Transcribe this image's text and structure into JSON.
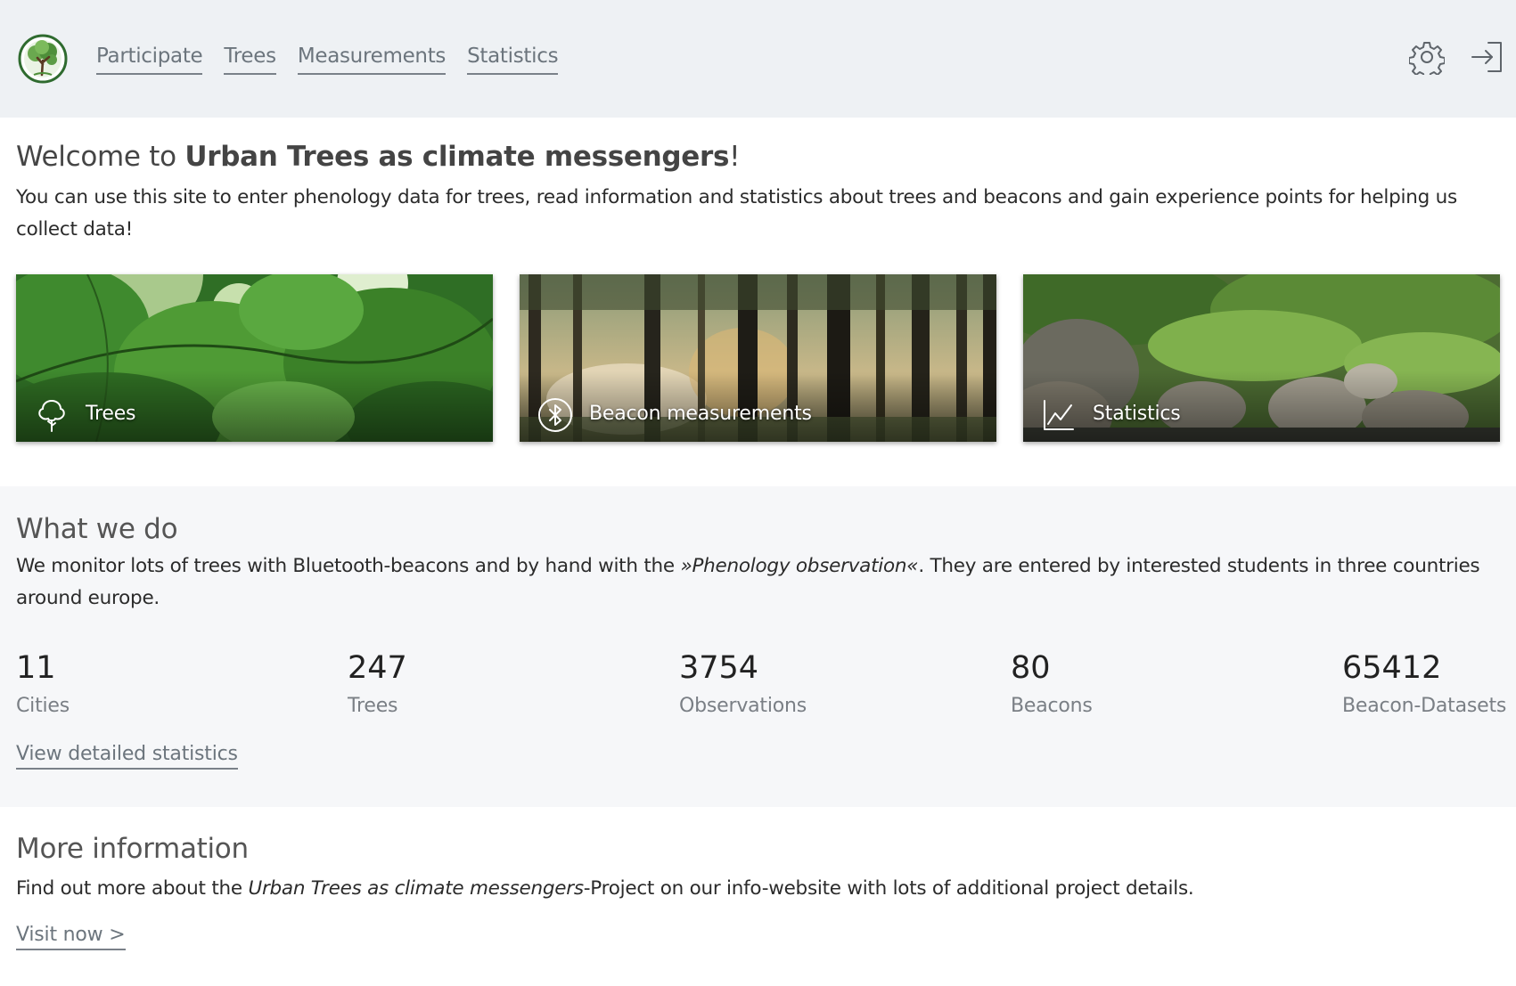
{
  "header": {
    "nav": [
      {
        "label": "Participate"
      },
      {
        "label": "Trees"
      },
      {
        "label": "Measurements"
      },
      {
        "label": "Statistics"
      }
    ]
  },
  "intro": {
    "welcome_prefix": "Welcome to ",
    "welcome_name": "Urban Trees as climate messengers",
    "welcome_suffix": "!",
    "text": "You can use this site to enter phenology data for trees, read information and statistics about trees and beacons and gain experience points for helping us collect data!"
  },
  "cards": [
    {
      "label": "Trees",
      "icon": "tree-icon"
    },
    {
      "label": "Beacon measurements",
      "icon": "bluetooth-icon"
    },
    {
      "label": "Statistics",
      "icon": "chart-line-icon"
    }
  ],
  "what_we_do": {
    "title": "What we do",
    "text_before": "We monitor lots of trees with Bluetooth-beacons and by hand with the ",
    "text_em": "»Phenology observation«",
    "text_after": ". They are entered by interested students in three countries around europe.",
    "stats": [
      {
        "value": "11",
        "label": "Cities"
      },
      {
        "value": "247",
        "label": "Trees"
      },
      {
        "value": "3754",
        "label": "Observations"
      },
      {
        "value": "80",
        "label": "Beacons"
      },
      {
        "value": "65412",
        "label": "Beacon-Datasets"
      }
    ],
    "link": "View detailed statistics"
  },
  "more_info": {
    "title": "More information",
    "text_before": "Find out more about the ",
    "text_em": "Urban Trees as climate messengers",
    "text_after": "-Project on our info-website with lots of additional project details.",
    "link": "Visit now >"
  },
  "colors": {
    "header_bg": "#eef1f4",
    "section_bg": "#f6f7f9",
    "link_gray": "#6c757d"
  }
}
